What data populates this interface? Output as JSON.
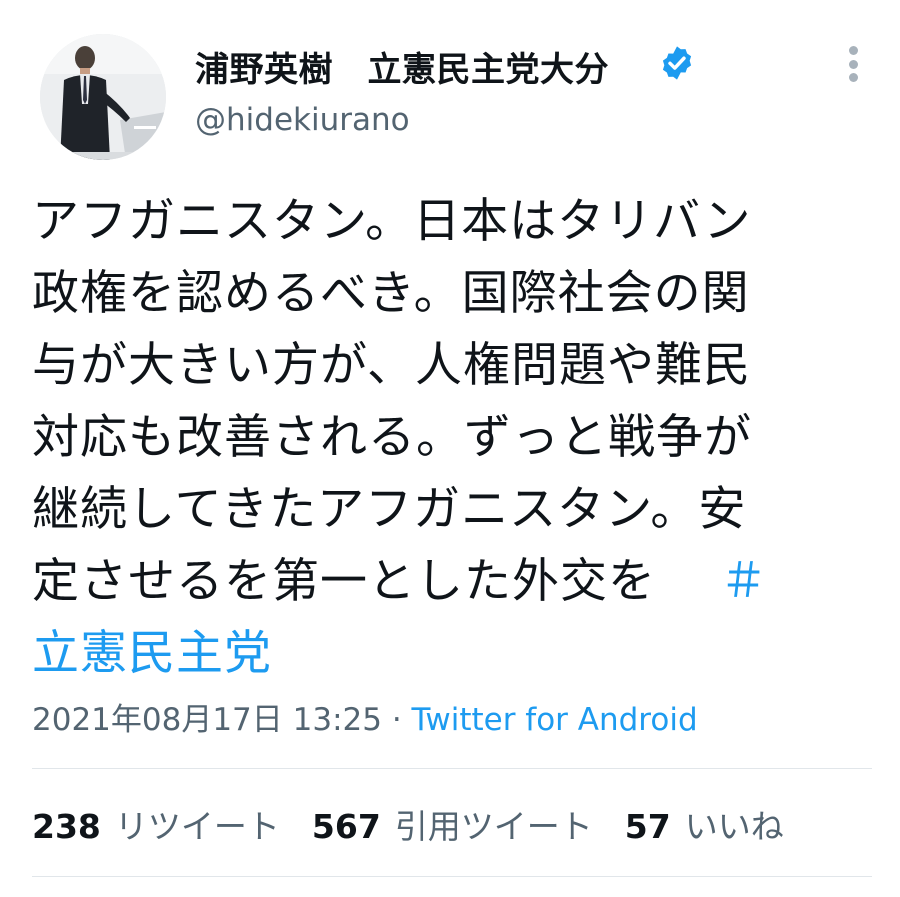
{
  "user": {
    "display_name": "浦野英樹　立憲民主党大分",
    "handle": "@hideki​urano",
    "verified": true,
    "avatar_icon": "person-at-podium-avatar",
    "badge_color": "#1d9bf0"
  },
  "tweet": {
    "lines": [
      "アフガニスタン。日本はタリバン",
      "政権を認めるべき。国際社会の関",
      "与が大きい方が、人権問題や難民",
      "対応も改善される。ずっと戦争が",
      "継続してきたアフガニスタン。安",
      "定させるを第一とした外交を"
    ],
    "hashtag_prefix": "＃",
    "hashtag": "立憲民主党"
  },
  "meta": {
    "datetime": "2021年08月17日 13:25",
    "separator": " · ",
    "source": "Twitter for Android"
  },
  "stats": {
    "retweets_count": "238",
    "retweets_label": "リツイート",
    "quotes_count": "567",
    "quotes_label": "引用ツイート",
    "likes_count": "57",
    "likes_label": "いいね"
  },
  "colors": {
    "link": "#1d9bf0",
    "secondary_text": "#536471",
    "primary_text": "#0f1419"
  }
}
